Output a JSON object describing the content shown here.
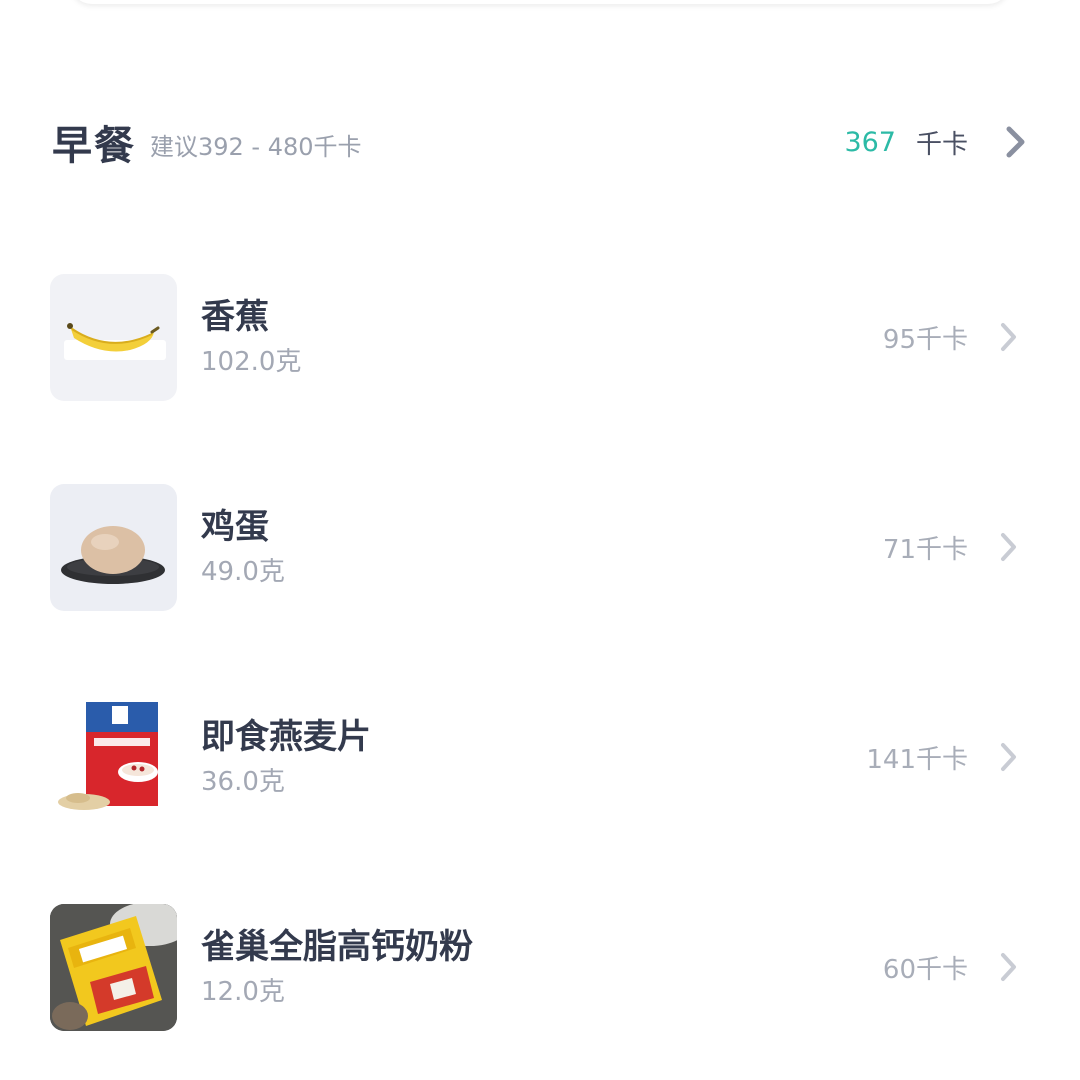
{
  "meal": {
    "title": "早餐",
    "suggestion": "建议392 - 480千卡",
    "total": "367",
    "unit": "千卡",
    "total_color": "#2cbaa6",
    "chevron_icon": "chevron-right-icon"
  },
  "foods": [
    {
      "name": "香蕉",
      "weight": "102.0克",
      "calories": "95千卡",
      "image": "banana-photo"
    },
    {
      "name": "鸡蛋",
      "weight": "49.0克",
      "calories": "71千卡",
      "image": "egg-photo"
    },
    {
      "name": "即食燕麦片",
      "weight": "36.0克",
      "calories": "141千卡",
      "image": "oatmeal-package-photo"
    },
    {
      "name": "雀巢全脂高钙奶粉",
      "weight": "12.0克",
      "calories": "60千卡",
      "image": "milk-powder-package-photo"
    }
  ]
}
